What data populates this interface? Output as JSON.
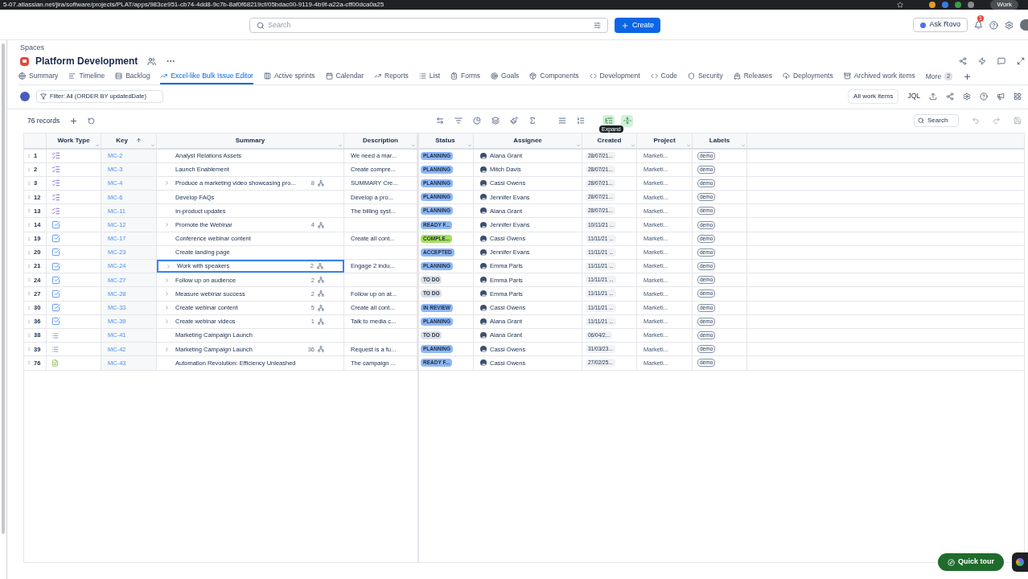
{
  "browser": {
    "url": "5-07.atlassian.net/jira/software/projects/PLAT/apps/983ce951-cb74-4dd8-9c7b-8af0f68219cf/05bdac00-9119-4b9f-a22a-cff00dca0a25",
    "profile": "Work"
  },
  "topbar": {
    "search_placeholder": "Search",
    "create": "Create",
    "ask": "Ask Rovo",
    "notifications": "1"
  },
  "breadcrumb": "Spaces",
  "space_title": "Platform Development",
  "tabs": [
    {
      "label": "Summary",
      "selected": false
    },
    {
      "label": "Timeline",
      "selected": false
    },
    {
      "label": "Backlog",
      "selected": false
    },
    {
      "label": "Excel-like Bulk Issue Editor",
      "selected": true
    },
    {
      "label": "Active sprints",
      "selected": false
    },
    {
      "label": "Calendar",
      "selected": false
    },
    {
      "label": "Reports",
      "selected": false
    },
    {
      "label": "List",
      "selected": false
    },
    {
      "label": "Forms",
      "selected": false
    },
    {
      "label": "Goals",
      "selected": false
    },
    {
      "label": "Components",
      "selected": false
    },
    {
      "label": "Development",
      "selected": false
    },
    {
      "label": "Code",
      "selected": false
    },
    {
      "label": "Security",
      "selected": false
    },
    {
      "label": "Releases",
      "selected": false
    },
    {
      "label": "Deployments",
      "selected": false
    },
    {
      "label": "Archived work items",
      "selected": false
    }
  ],
  "more": {
    "label": "More",
    "count": "2"
  },
  "filter": "Filter: All (ORDER BY updatedDate)",
  "all_items": "All work items",
  "jql": "JQL",
  "records": "76 records",
  "table_search": "Search",
  "tooltip": "Expand",
  "columns": [
    "Work Type",
    "Key",
    "Summary",
    "Description",
    "Status",
    "Assignee",
    "Created",
    "Project",
    "Labels"
  ],
  "rows": [
    {
      "num": "1",
      "kind": "checklist",
      "key": "MC-2",
      "expandable": false,
      "summary": "Analyst Relations Assets",
      "children": "",
      "description": "We need a mar...",
      "status": "PLANNING",
      "color": "#8fb8f6",
      "assignee": "Alana Grant",
      "created": "28/07/21...",
      "project": "Marketi...",
      "label": "demo",
      "selected": false
    },
    {
      "num": "2",
      "kind": "checklist",
      "key": "MC-3",
      "expandable": false,
      "summary": "Launch Enablement",
      "children": "",
      "description": "Create compre...",
      "status": "PLANNING",
      "color": "#8fb8f6",
      "assignee": "Mitch Davis",
      "created": "28/07/21...",
      "project": "Marketi...",
      "label": "demo",
      "selected": false
    },
    {
      "num": "3",
      "kind": "checklist",
      "key": "MC-4",
      "expandable": true,
      "summary": "Produce a marketing video showcasing pro...",
      "children": "8",
      "description": "SUMMARY Cre...",
      "status": "PLANNING",
      "color": "#8fb8f6",
      "assignee": "Cassi Owens",
      "created": "28/07/21...",
      "project": "Marketi...",
      "label": "demo",
      "selected": false
    },
    {
      "num": "12",
      "kind": "checklist",
      "key": "MC-6",
      "expandable": false,
      "summary": "Develop FAQs",
      "children": "",
      "description": "Develop a pro...",
      "status": "PLANNING",
      "color": "#8fb8f6",
      "assignee": "Jennifer Evans",
      "created": "28/07/21...",
      "project": "Marketi...",
      "label": "demo",
      "selected": false
    },
    {
      "num": "13",
      "kind": "checklist",
      "key": "MC-11",
      "expandable": false,
      "summary": "In-product updates",
      "children": "",
      "description": "The billing syst...",
      "status": "PLANNING",
      "color": "#8fb8f6",
      "assignee": "Alana Grant",
      "created": "28/07/21...",
      "project": "Marketi...",
      "label": "demo",
      "selected": false
    },
    {
      "num": "14",
      "kind": "checkbox",
      "key": "MC-12",
      "expandable": true,
      "summary": "Promote the Webinar",
      "children": "4",
      "description": "",
      "status": "READY F...",
      "color": "#8fb8f6",
      "assignee": "Jennifer Evans",
      "created": "10/11/21 ...",
      "project": "Marketi...",
      "label": "demo",
      "selected": false
    },
    {
      "num": "19",
      "kind": "checkbox",
      "key": "MC-17",
      "expandable": false,
      "summary": "Conference webinar content",
      "children": "",
      "description": "Create all cont...",
      "status": "COMPLE...",
      "color": "#a6e05a",
      "assignee": "Cassi Owens",
      "created": "11/11/21 ...",
      "project": "Marketi...",
      "label": "demo",
      "selected": false
    },
    {
      "num": "20",
      "kind": "checkbox",
      "key": "MC-23",
      "expandable": false,
      "summary": "Create landing page",
      "children": "",
      "description": "",
      "status": "ACCEPTED",
      "color": "#8fb8f6",
      "assignee": "Jennifer Evans",
      "created": "11/11/21 ...",
      "project": "Marketi...",
      "label": "demo",
      "selected": false
    },
    {
      "num": "21",
      "kind": "checkbox",
      "key": "MC-24",
      "expandable": true,
      "summary": "Work with speakers",
      "children": "2",
      "description": "Engage 2 indu...",
      "status": "PLANNING",
      "color": "#8fb8f6",
      "assignee": "Emma Paris",
      "created": "11/11/21 ...",
      "project": "Marketi...",
      "label": "demo",
      "selected": true
    },
    {
      "num": "24",
      "kind": "checkbox",
      "key": "MC-27",
      "expandable": true,
      "summary": "Follow up on audience",
      "children": "2",
      "description": "",
      "status": "TO DO",
      "color": "#dcdfe4",
      "assignee": "Emma Paris",
      "created": "11/11/21 ...",
      "project": "Marketi...",
      "label": "demo",
      "selected": false
    },
    {
      "num": "27",
      "kind": "checkbox",
      "key": "MC-28",
      "expandable": true,
      "summary": "Measure webinar success",
      "children": "2",
      "description": "Follow up on at...",
      "status": "TO DO",
      "color": "#dcdfe4",
      "assignee": "Emma Paris",
      "created": "11/11/21 ...",
      "project": "Marketi...",
      "label": "demo",
      "selected": false
    },
    {
      "num": "30",
      "kind": "checkbox",
      "key": "MC-33",
      "expandable": true,
      "summary": "Create webinar content",
      "children": "5",
      "description": "Create all cont...",
      "status": "IN REVIEW",
      "color": "#8fb8f6",
      "assignee": "Cassi Owens",
      "created": "11/11/21 ...",
      "project": "Marketi...",
      "label": "demo",
      "selected": false
    },
    {
      "num": "36",
      "kind": "checkbox",
      "key": "MC-39",
      "expandable": true,
      "summary": "Create webinar videos",
      "children": "1",
      "description": "Talk to media c...",
      "status": "PLANNING",
      "color": "#8fb8f6",
      "assignee": "Alana Grant",
      "created": "11/11/21 ...",
      "project": "Marketi...",
      "label": "demo",
      "selected": false
    },
    {
      "num": "38",
      "kind": "bullets",
      "key": "MC-41",
      "expandable": false,
      "summary": "Marketing Campaign Launch",
      "children": "",
      "description": "",
      "status": "TO DO",
      "color": "#dcdfe4",
      "assignee": "Alana Grant",
      "created": "06/04/2...",
      "project": "Marketi...",
      "label": "demo",
      "selected": false
    },
    {
      "num": "39",
      "kind": "bullets",
      "key": "MC-42",
      "expandable": true,
      "summary": "Marketing Campaign Launch",
      "children": "36",
      "description": "Request is a fu...",
      "status": "PLANNING",
      "color": "#8fb8f6",
      "assignee": "Cassi Owens",
      "created": "31/03/23...",
      "project": "Marketi...",
      "label": "demo",
      "selected": false
    },
    {
      "num": "76",
      "kind": "page",
      "key": "MC-43",
      "expandable": false,
      "summary": "Automation Revolution: Efficiency Unleashed",
      "children": "",
      "description": "The campaign ...",
      "status": "READY F...",
      "color": "#8fb8f6",
      "assignee": "Cassi Owens",
      "created": "27/02/25...",
      "project": "Marketi...",
      "label": "demo",
      "selected": false
    }
  ],
  "quick_tour": "Quick tour"
}
